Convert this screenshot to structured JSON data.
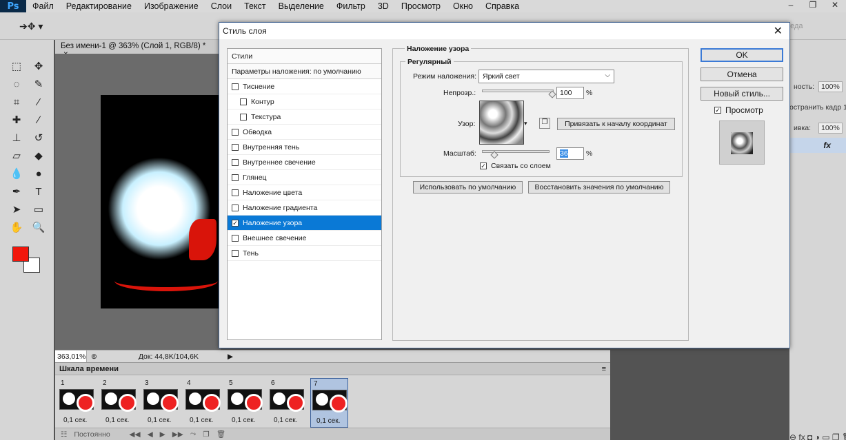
{
  "app": {
    "logo": "Ps",
    "menu": [
      "Файл",
      "Редактирование",
      "Изображение",
      "Слои",
      "Текст",
      "Выделение",
      "Фильтр",
      "3D",
      "Просмотр",
      "Окно",
      "Справка"
    ],
    "window_controls": [
      "–",
      "❐",
      "✕"
    ]
  },
  "options_bar": {
    "ghost_text": "реда"
  },
  "document": {
    "tab_title": "Без имени-1 @ 363% (Слой 1, RGB/8) *",
    "tab_close": "×",
    "zoom": "363,01%",
    "doc_info": "Док: 44,8K/104,6K"
  },
  "timeline": {
    "title": "Шкала времени",
    "frames": [
      {
        "num": "1",
        "delay": "0,1 сек."
      },
      {
        "num": "2",
        "delay": "0,1 сек."
      },
      {
        "num": "3",
        "delay": "0,1 сек."
      },
      {
        "num": "4",
        "delay": "0,1 сек."
      },
      {
        "num": "5",
        "delay": "0,1 сек."
      },
      {
        "num": "6",
        "delay": "0,1 сек."
      },
      {
        "num": "7",
        "delay": "0,1 сек."
      }
    ],
    "selected_frame": 7,
    "loop": "Постоянно"
  },
  "right_panel": {
    "opacity_label": "ность:",
    "opacity_value": "100%",
    "unify_label": "остранить кадр 1",
    "fill_label": "ивка:",
    "fill_value": "100%"
  },
  "dialog": {
    "title": "Стиль слоя",
    "styles_header": "Стили",
    "blend_defaults": "Параметры наложения: по умолчанию",
    "styles": [
      {
        "label": "Тиснение",
        "checked": false,
        "indent": false
      },
      {
        "label": "Контур",
        "checked": false,
        "indent": true
      },
      {
        "label": "Текстура",
        "checked": false,
        "indent": true
      },
      {
        "label": "Обводка",
        "checked": false,
        "indent": false
      },
      {
        "label": "Внутренняя тень",
        "checked": false,
        "indent": false
      },
      {
        "label": "Внутреннее свечение",
        "checked": false,
        "indent": false
      },
      {
        "label": "Глянец",
        "checked": false,
        "indent": false
      },
      {
        "label": "Наложение цвета",
        "checked": false,
        "indent": false
      },
      {
        "label": "Наложение градиента",
        "checked": false,
        "indent": false
      },
      {
        "label": "Наложение узора",
        "checked": true,
        "indent": false
      },
      {
        "label": "Внешнее свечение",
        "checked": false,
        "indent": false
      },
      {
        "label": "Тень",
        "checked": false,
        "indent": false
      }
    ],
    "section_title": "Наложение узора",
    "group_title": "Регулярный",
    "blend_mode_label": "Режим наложения:",
    "blend_mode_value": "Яркий свет",
    "opacity_label": "Непрозр.:",
    "opacity_value": "100",
    "opacity_fraction": 0.97,
    "pattern_label": "Узор:",
    "snap_button": "Привязать к началу координат",
    "scale_label": "Масштаб:",
    "scale_value": "36",
    "scale_fraction": 0.17,
    "percent": "%",
    "link_label": "Связать со слоем",
    "link_checked": true,
    "make_default": "Использовать по умолчанию",
    "reset_default": "Восстановить значения по умолчанию",
    "ok": "OK",
    "cancel": "Отмена",
    "new_style": "Новый стиль...",
    "preview_label": "Просмотр",
    "preview_checked": true
  },
  "colors": {
    "foreground": "#f2170c",
    "background": "#ffffff",
    "selection": "#0a79d6"
  }
}
